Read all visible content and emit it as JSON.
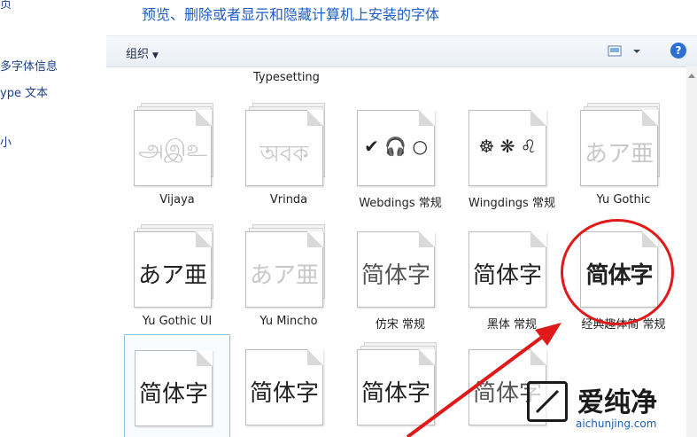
{
  "heading": "预览、删除或者显示和隐藏计算机上安装的字体",
  "left_links": [
    "页",
    "多字体信息",
    "ype 文本",
    "小"
  ],
  "toolbar": {
    "organize_label": "组织",
    "help_label": "?"
  },
  "top_text": "Typesetting",
  "fonts": [
    {
      "sample": "அஇஉ",
      "label": "Vijaya",
      "style": "light"
    },
    {
      "sample": "অবক",
      "label": "Vrinda",
      "style": "light"
    },
    {
      "sample": "✔ 🎧 ○",
      "label": "Webdings 常规",
      "style": "sym"
    },
    {
      "sample": "☸ ❋ ♌",
      "label": "Wingdings 常规",
      "style": "sym"
    },
    {
      "sample": "あア亜",
      "label": "Yu Gothic",
      "style": "light"
    },
    {
      "sample": "あア亜",
      "label": "Yu Gothic UI",
      "style": "normal"
    },
    {
      "sample": "あア亜",
      "label": "Yu Mincho",
      "style": "light"
    },
    {
      "sample": "简体字",
      "label": "仿宋 常规",
      "style": "normal"
    },
    {
      "sample": "简体字",
      "label": "黑体 常规",
      "style": "normal"
    },
    {
      "sample": "简体字",
      "label": "经典趣体简 常规",
      "style": "heavy"
    },
    {
      "sample": "简体字",
      "label": "",
      "style": "normal"
    },
    {
      "sample": "简体字",
      "label": "",
      "style": "normal"
    },
    {
      "sample": "简体字",
      "label": "",
      "style": "normal"
    },
    {
      "sample": "简体字",
      "label": "",
      "style": "normal"
    }
  ],
  "watermark": {
    "text": "爱纯净",
    "url": "aichunjing.com"
  }
}
